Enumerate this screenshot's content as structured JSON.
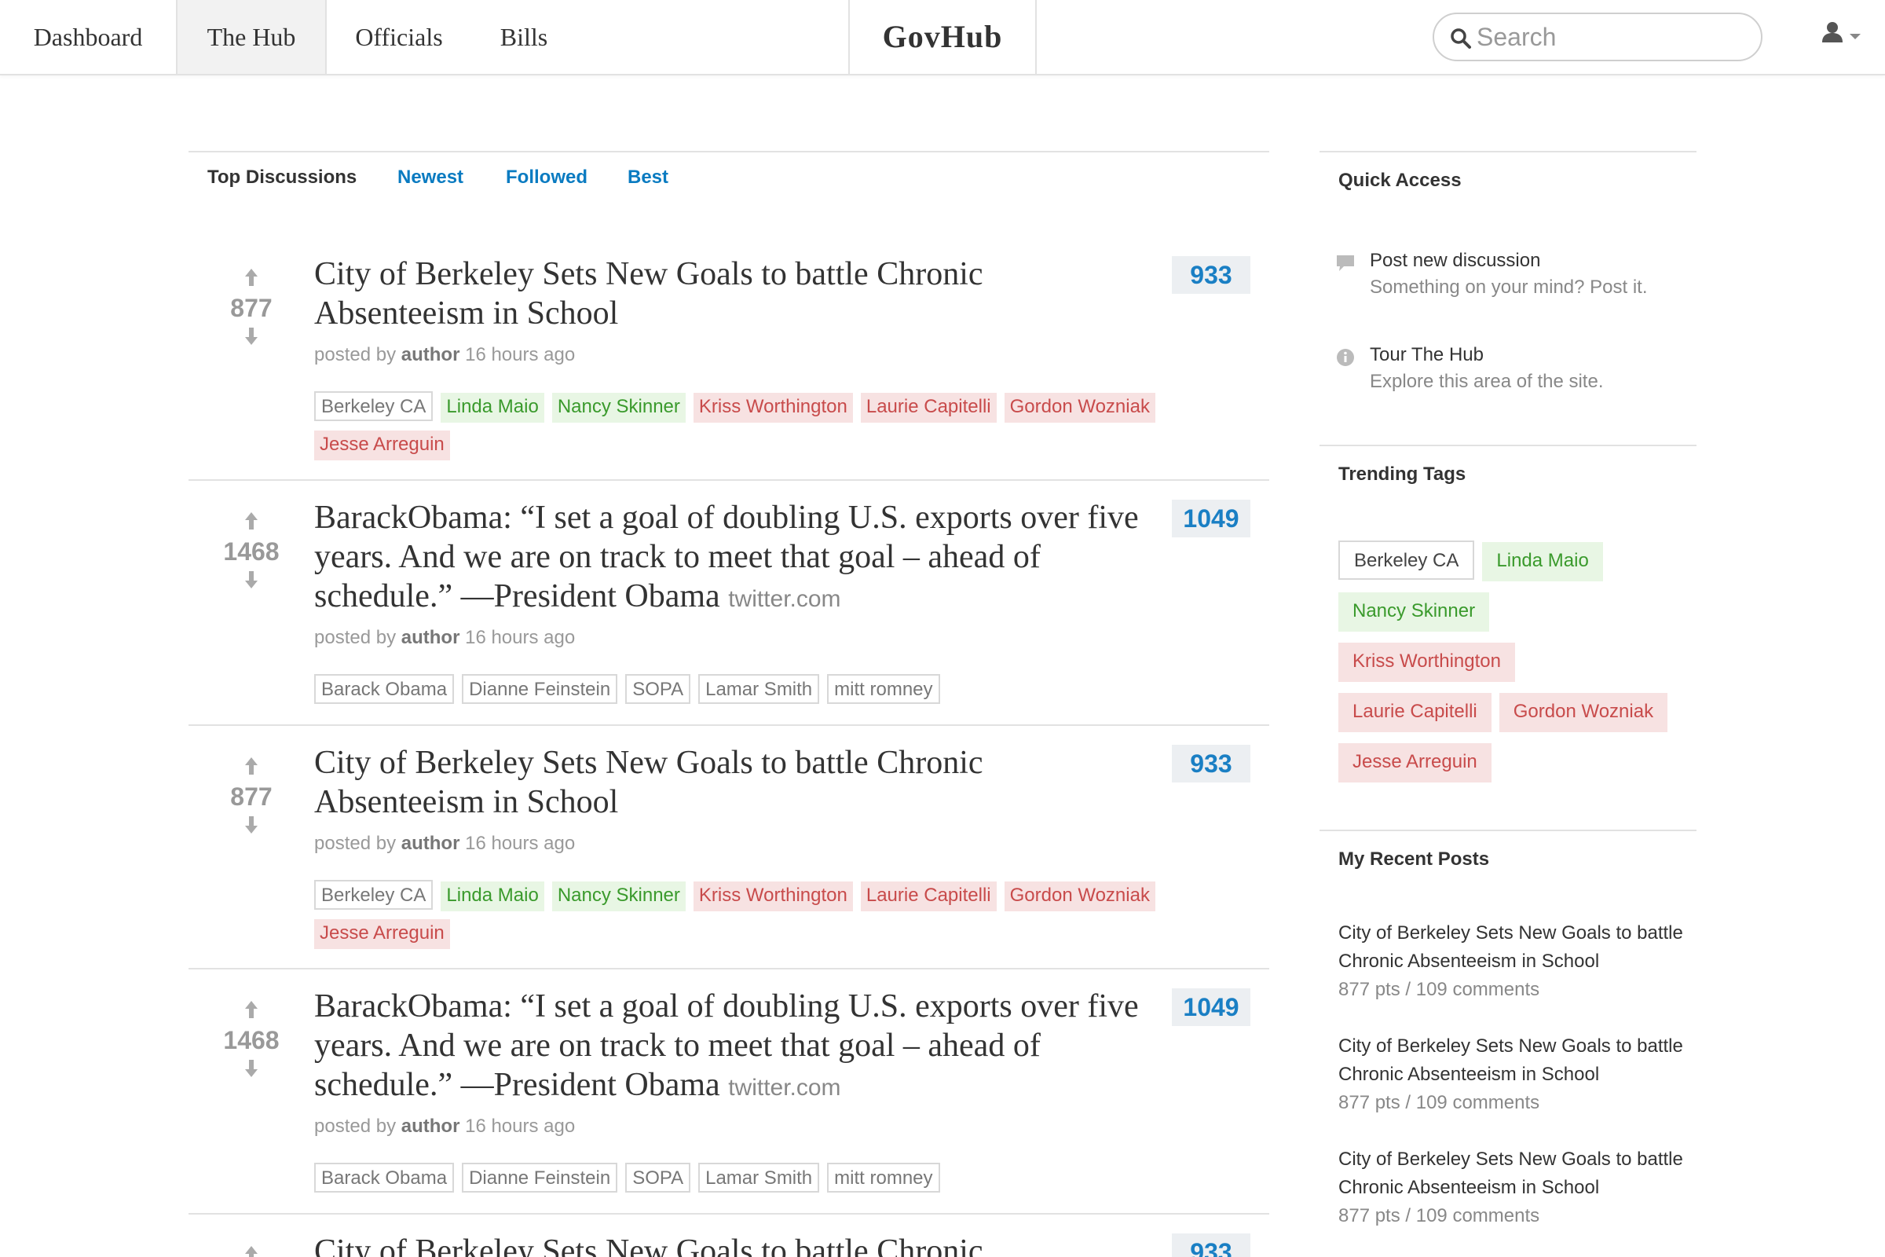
{
  "nav": {
    "items": [
      "Dashboard",
      "The Hub",
      "Officials",
      "Bills"
    ],
    "active": "The Hub",
    "brand": "GovHub",
    "search_placeholder": "Search"
  },
  "tabs": [
    "Top Discussions",
    "Newest",
    "Followed",
    "Best"
  ],
  "active_tab": "Top Discussions",
  "posts": [
    {
      "score": "877",
      "title": "City of Berkeley Sets New Goals to battle Chronic Absenteeism in School",
      "source": "",
      "posted_prefix": "posted by",
      "author": "author",
      "time": "16 hours ago",
      "comments": "933",
      "tags": [
        {
          "label": "Berkeley CA",
          "kind": "neutral"
        },
        {
          "label": "Linda Maio",
          "kind": "green"
        },
        {
          "label": "Nancy Skinner",
          "kind": "green"
        },
        {
          "label": "Kriss Worthington",
          "kind": "red"
        },
        {
          "label": "Laurie Capitelli",
          "kind": "red"
        },
        {
          "label": "Gordon Wozniak",
          "kind": "red"
        },
        {
          "label": "Jesse Arreguin",
          "kind": "red"
        }
      ]
    },
    {
      "score": "1468",
      "title": "BarackObama: “I set a goal of doubling U.S. exports over five years. And we are on track to meet that goal – ahead of schedule.” —President Obama",
      "source": "twitter.com",
      "posted_prefix": "posted by",
      "author": "author",
      "time": "16 hours ago",
      "comments": "1049",
      "tags": [
        {
          "label": "Barack Obama",
          "kind": "neutral"
        },
        {
          "label": "Dianne Feinstein",
          "kind": "neutral"
        },
        {
          "label": "SOPA",
          "kind": "neutral"
        },
        {
          "label": "Lamar Smith",
          "kind": "neutral"
        },
        {
          "label": "mitt romney",
          "kind": "neutral"
        }
      ]
    },
    {
      "score": "877",
      "title": "City of Berkeley Sets New Goals to battle Chronic Absenteeism in School",
      "source": "",
      "posted_prefix": "posted by",
      "author": "author",
      "time": "16 hours ago",
      "comments": "933",
      "tags": [
        {
          "label": "Berkeley CA",
          "kind": "neutral"
        },
        {
          "label": "Linda Maio",
          "kind": "green"
        },
        {
          "label": "Nancy Skinner",
          "kind": "green"
        },
        {
          "label": "Kriss Worthington",
          "kind": "red"
        },
        {
          "label": "Laurie Capitelli",
          "kind": "red"
        },
        {
          "label": "Gordon Wozniak",
          "kind": "red"
        },
        {
          "label": "Jesse Arreguin",
          "kind": "red"
        }
      ]
    },
    {
      "score": "1468",
      "title": "BarackObama: “I set a goal of doubling U.S. exports over five years. And we are on track to meet that goal – ahead of schedule.” —President Obama",
      "source": "twitter.com",
      "posted_prefix": "posted by",
      "author": "author",
      "time": "16 hours ago",
      "comments": "1049",
      "tags": [
        {
          "label": "Barack Obama",
          "kind": "neutral"
        },
        {
          "label": "Dianne Feinstein",
          "kind": "neutral"
        },
        {
          "label": "SOPA",
          "kind": "neutral"
        },
        {
          "label": "Lamar Smith",
          "kind": "neutral"
        },
        {
          "label": "mitt romney",
          "kind": "neutral"
        }
      ]
    },
    {
      "score": "",
      "title": "City of Berkeley Sets New Goals to battle Chronic",
      "source": "",
      "posted_prefix": "",
      "author": "",
      "time": "",
      "comments": "933",
      "tags": []
    }
  ],
  "sidebar": {
    "quick_access": {
      "heading": "Quick Access",
      "items": [
        {
          "title": "Post new discussion",
          "subtitle": "Something on your mind? Post it.",
          "icon": "comment-icon"
        },
        {
          "title": "Tour The Hub",
          "subtitle": "Explore this area of the site.",
          "icon": "info-icon"
        }
      ]
    },
    "trending": {
      "heading": "Trending Tags",
      "tags": [
        {
          "label": "Berkeley CA",
          "kind": "neutral"
        },
        {
          "label": "Linda Maio",
          "kind": "green"
        },
        {
          "label": "Nancy Skinner",
          "kind": "green"
        },
        {
          "label": "Kriss Worthington",
          "kind": "red"
        },
        {
          "label": "Laurie Capitelli",
          "kind": "red"
        },
        {
          "label": "Gordon Wozniak",
          "kind": "red"
        },
        {
          "label": "Jesse Arreguin",
          "kind": "red"
        }
      ]
    },
    "recent": {
      "heading": "My Recent Posts",
      "items": [
        {
          "title": "City of Berkeley Sets New Goals to battle Chronic Absenteeism in School",
          "meta": "877 pts / 109 comments"
        },
        {
          "title": "City of Berkeley Sets New Goals to battle Chronic Absenteeism in School",
          "meta": "877 pts / 109 comments"
        },
        {
          "title": "City of Berkeley Sets New Goals to battle Chronic Absenteeism in School",
          "meta": "877 pts / 109 comments"
        }
      ]
    }
  },
  "colors": {
    "link_blue": "#0a7bc1",
    "count_blue": "#1a7fc4",
    "count_bg": "#eceff2",
    "tag_green_bg": "#e8f6e4",
    "tag_green_fg": "#3a9a2c",
    "tag_red_bg": "#f7e2e2",
    "tag_red_fg": "#c84b4b",
    "rule": "#e2e2e2"
  }
}
